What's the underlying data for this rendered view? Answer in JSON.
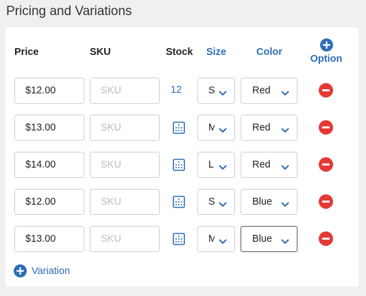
{
  "section": {
    "title": "Pricing and Variations"
  },
  "headers": {
    "price": "Price",
    "sku": "SKU",
    "stock": "Stock",
    "size": "Size",
    "color": "Color",
    "option": "Option"
  },
  "rows": [
    {
      "price": "$12.00",
      "sku_placeholder": "SKU",
      "sku": "",
      "stock": "12",
      "stock_icon": "grid-icon",
      "size": "S",
      "color": "Red"
    },
    {
      "price": "$13.00",
      "sku_placeholder": "SKU",
      "sku": "",
      "stock": "",
      "stock_icon": "grid-icon",
      "size": "M",
      "color": "Red"
    },
    {
      "price": "$14.00",
      "sku_placeholder": "SKU",
      "sku": "",
      "stock": "",
      "stock_icon": "grid-icon",
      "size": "L",
      "color": "Red"
    },
    {
      "price": "$12.00",
      "sku_placeholder": "SKU",
      "sku": "",
      "stock": "",
      "stock_icon": "grid-icon",
      "size": "S",
      "color": "Blue"
    },
    {
      "price": "$13.00",
      "sku_placeholder": "SKU",
      "sku": "",
      "stock": "",
      "stock_icon": "grid-icon",
      "size": "M",
      "color": "Blue"
    }
  ],
  "footer": {
    "add_variation": "Variation"
  },
  "icons": {
    "add_option": "plus-circle-icon",
    "add_variation": "plus-circle-icon",
    "remove_row": "minus-circle-icon",
    "dropdown": "chevron-down-icon"
  },
  "colors": {
    "accent": "#2d6db5",
    "danger": "#e53935",
    "page_background": "#f0f0f0",
    "card_background": "#ffffff",
    "border": "#cfcfcf",
    "placeholder": "#bdbdbd"
  }
}
